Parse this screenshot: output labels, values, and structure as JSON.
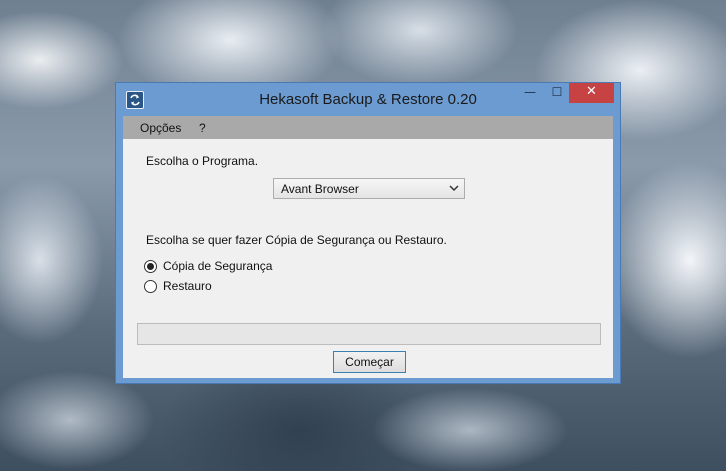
{
  "window": {
    "title": "Hekasoft Backup & Restore 0.20",
    "icon": "sync-arrows-icon",
    "controls": {
      "minimize_glyph": "—",
      "maximize_glyph": "☐",
      "close_glyph": "✕"
    },
    "close_color": "#c74242"
  },
  "menu": {
    "items": [
      {
        "label": "Opções"
      },
      {
        "label": "?"
      }
    ]
  },
  "program": {
    "label": "Escolha o Programa.",
    "selected": "Avant Browser"
  },
  "mode": {
    "label": "Escolha se quer fazer Cópia de Segurança ou Restauro.",
    "options": [
      {
        "label": "Cópia de Segurança",
        "checked": true
      },
      {
        "label": "Restauro",
        "checked": false
      }
    ]
  },
  "progress": {
    "percent": 0
  },
  "actions": {
    "start_label": "Começar"
  }
}
